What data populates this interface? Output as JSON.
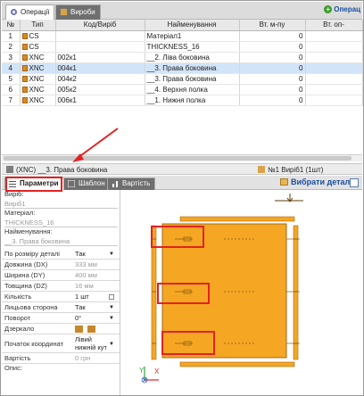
{
  "top_tabs": {
    "operations": "Операції",
    "products": "Вироби"
  },
  "add_operation": "Операц",
  "grid": {
    "headers": [
      "№",
      "Тип",
      "Код/Виріб",
      "Найменування",
      "Вт. м-пу",
      "Вт. оп-"
    ],
    "rows": [
      {
        "n": "1",
        "type": "CS",
        "code": "",
        "name": "Матеріал1",
        "loss": "0"
      },
      {
        "n": "2",
        "type": "CS",
        "code": "",
        "name": "THICKNESS_16",
        "loss": "0"
      },
      {
        "n": "3",
        "type": "XNC",
        "code": "002к1",
        "name": "__2. Ліва боковина",
        "loss": "0"
      },
      {
        "n": "4",
        "type": "XNC",
        "code": "004к1",
        "name": "__3. Права боковина",
        "loss": "0"
      },
      {
        "n": "5",
        "type": "XNC",
        "code": "004к2",
        "name": "__3. Права боковина",
        "loss": "0"
      },
      {
        "n": "6",
        "type": "XNC",
        "code": "005к2",
        "name": "__4. Верхня полка",
        "loss": "0"
      },
      {
        "n": "7",
        "type": "XNC",
        "code": "006к1",
        "name": "__1. Нижня полка",
        "loss": "0"
      }
    ]
  },
  "infobar": {
    "left": "(XNC) __3. Права боковина",
    "right": "№1 Виріб1 (1шт)"
  },
  "sub_tabs": {
    "params": "Параметри",
    "template": "Шаблон",
    "cost": "Вартість"
  },
  "choose_part": "Вибрати деталь",
  "params": {
    "product_label": "Виріб:",
    "product_value": "Виріб1",
    "material_label": "Матеріал:",
    "material_value": "THICKNESS_16",
    "name_label": "Найменування:",
    "name_value": "__3. Права боковина",
    "rows": [
      {
        "k": "По розміру деталі",
        "v": "Так"
      },
      {
        "k": "Довжина (DX)",
        "v": "333 мм"
      },
      {
        "k": "Ширина (DY)",
        "v": "400 мм"
      },
      {
        "k": "Товщина (DZ)",
        "v": "16 мм"
      },
      {
        "k": "Кількість",
        "v": "1 шт"
      },
      {
        "k": "Лицьова сторона",
        "v": "Так"
      },
      {
        "k": "Поворот",
        "v": "0°"
      },
      {
        "k": "Дзеркало",
        "v": ""
      },
      {
        "k": "Початок координат",
        "v": "Лівий нижній кут"
      },
      {
        "k": "Вартість",
        "v": "0 грн"
      },
      {
        "k": "Опис:",
        "v": ""
      }
    ]
  },
  "axes": {
    "x": "X",
    "y": "Y"
  },
  "colors": {
    "part": "#f5a623",
    "part_border": "#a86a12",
    "highlight": "#e32222",
    "selected_row": "#d2e4f8",
    "link": "#1a4fa0"
  }
}
